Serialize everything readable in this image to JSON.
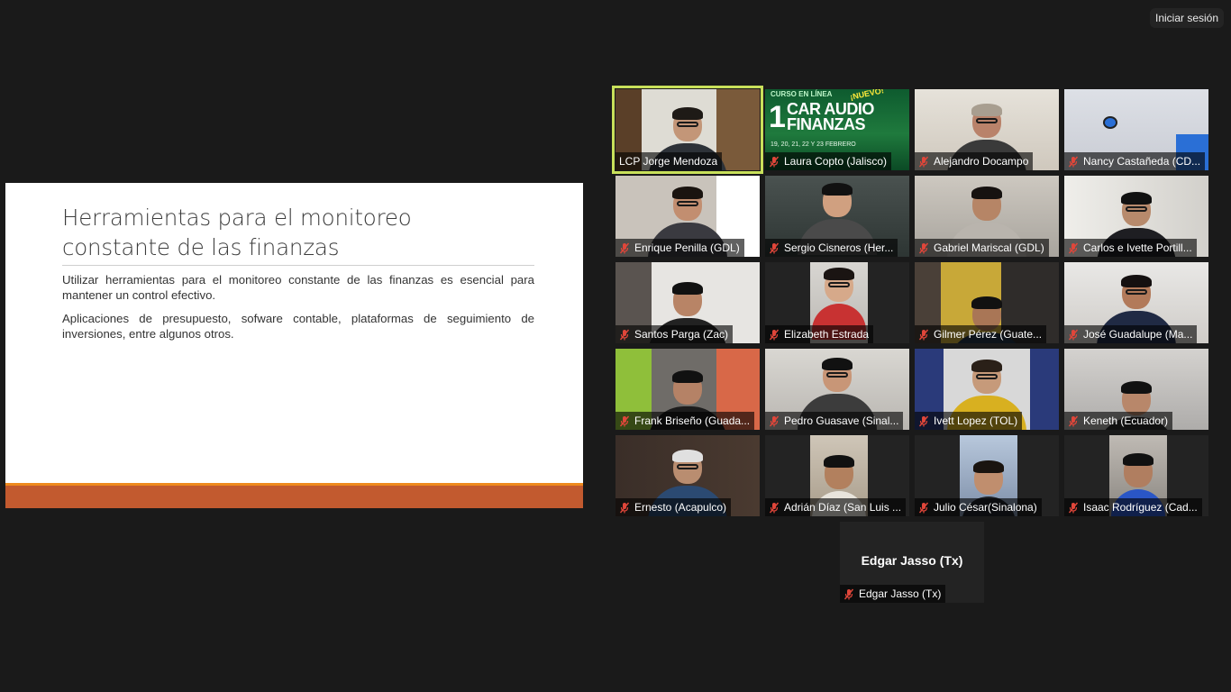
{
  "header": {
    "signin_label": "Iniciar sesión"
  },
  "slide": {
    "title": "Herramientas para el monitoreo constante de las finanzas",
    "paragraphs": [
      "Utilizar herramientas para el monitoreo constante de las finanzas es esencial para mantener un control efectivo.",
      "Aplicaciones de presupuesto, sofware contable, plataformas de seguimiento de inversiones, entre algunos otros."
    ],
    "accent_color": "#c25a2f"
  },
  "banner": {
    "line1": "CURSO EN LÍNEA",
    "nuevo": "¡NUEVO!",
    "number": "1",
    "big1": "CAR AUDIO",
    "big2": "FINANZAS",
    "dates": "19, 20, 21, 22 Y 23 FEBRERO"
  },
  "participants": [
    {
      "name": "LCP Jorge Mendoza",
      "muted": false,
      "active": true
    },
    {
      "name": "Laura Copto (Jalisco)",
      "muted": true
    },
    {
      "name": "Alejandro Docampo",
      "muted": true
    },
    {
      "name": "Nancy Castañeda (CD...",
      "muted": true
    },
    {
      "name": "Enrique Penilla (GDL)",
      "muted": true
    },
    {
      "name": "Sergio Cisneros (Her...",
      "muted": true
    },
    {
      "name": "Gabriel Mariscal (GDL)",
      "muted": true
    },
    {
      "name": "Carlos e Ivette Portill...",
      "muted": true
    },
    {
      "name": "Santos Parga (Zac)",
      "muted": true
    },
    {
      "name": "Elizabeth Estrada",
      "muted": true
    },
    {
      "name": "Gilmer Pérez (Guate...",
      "muted": true
    },
    {
      "name": "José Guadalupe (Ma...",
      "muted": true
    },
    {
      "name": "Frank Briseño (Guada...",
      "muted": true
    },
    {
      "name": "Pedro Guasave (Sinal...",
      "muted": true
    },
    {
      "name": "Ivett Lopez (TOL)",
      "muted": true
    },
    {
      "name": "Keneth (Ecuador)",
      "muted": true
    },
    {
      "name": "Ernesto (Acapulco)",
      "muted": true
    },
    {
      "name": "Adrián Díaz (San Luis ...",
      "muted": true
    },
    {
      "name": "Julio César(Sinalona)",
      "muted": true
    },
    {
      "name": "Isaac Rodríguez (Cad...",
      "muted": true
    }
  ],
  "solo": {
    "display_name": "Edgar Jasso (Tx)",
    "label": "Edgar Jasso (Tx)",
    "muted": true
  },
  "colors": {
    "active_speaker": "#c8e05a",
    "mute_icon": "#e0463a",
    "background": "#1a1a1a"
  }
}
